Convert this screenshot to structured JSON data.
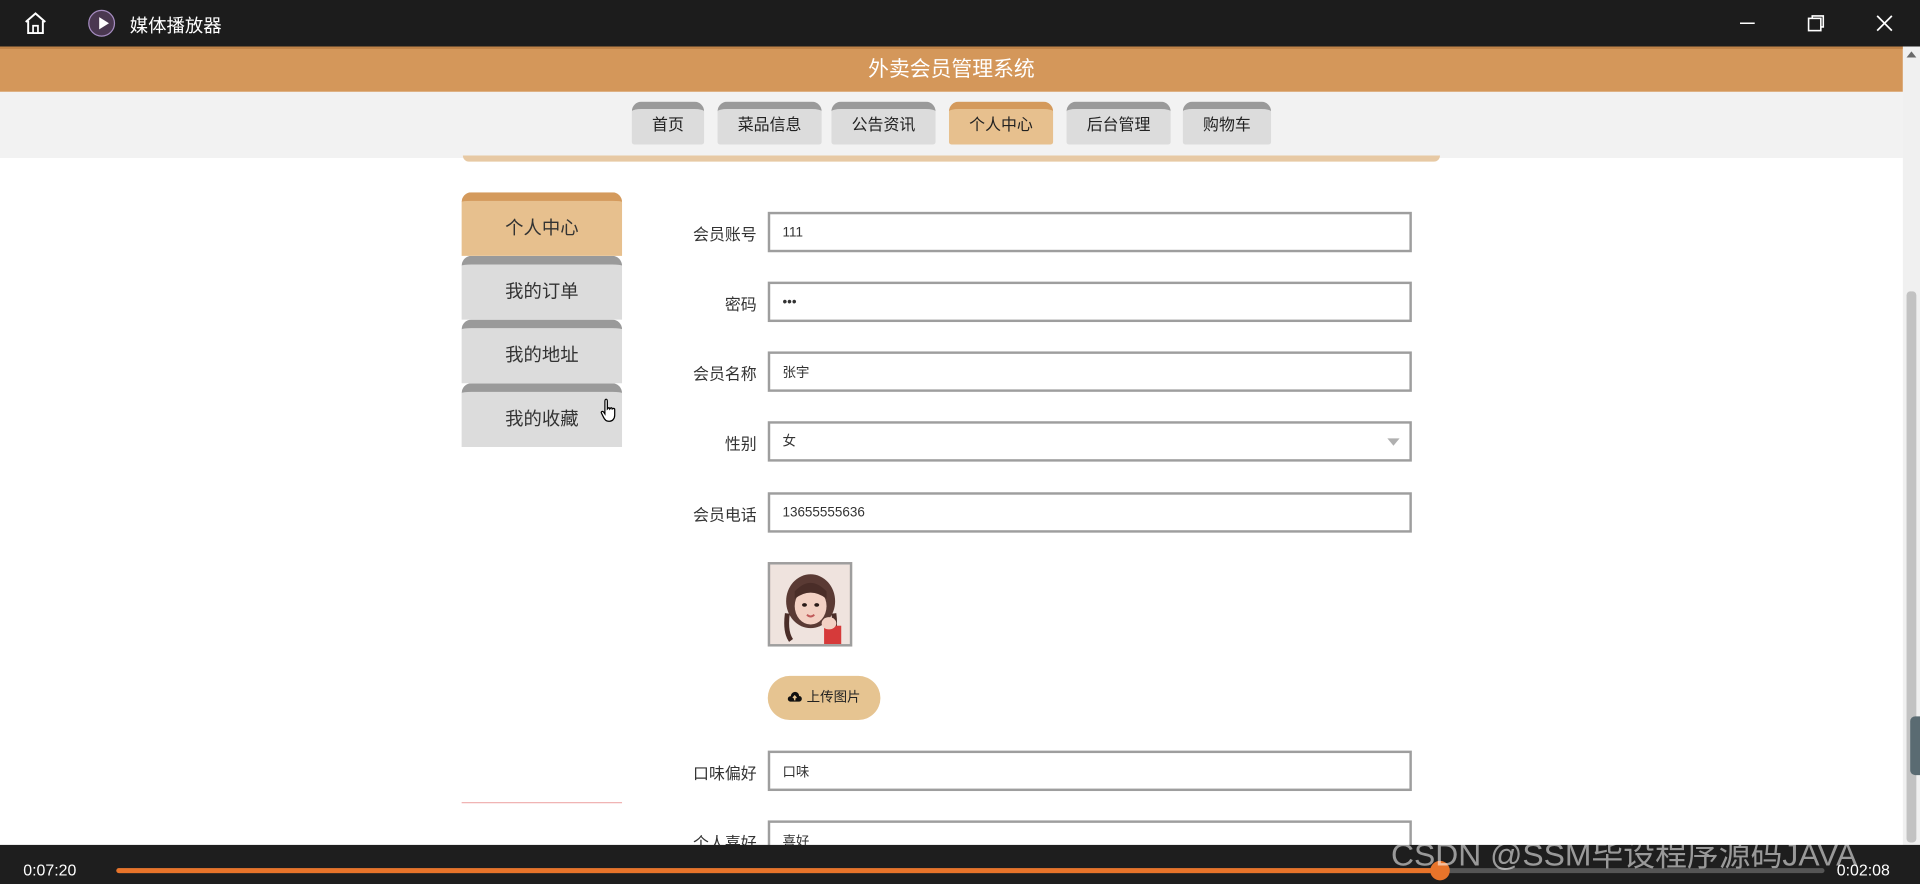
{
  "window": {
    "title": "媒体播放器",
    "icons": [
      "home-icon",
      "media-player-icon",
      "minimize-icon",
      "maximize-icon",
      "close-icon"
    ]
  },
  "site": {
    "title": "外卖会员管理系统",
    "nav": [
      {
        "label": "首页",
        "active": false
      },
      {
        "label": "菜品信息",
        "active": false
      },
      {
        "label": "公告资讯",
        "active": false
      },
      {
        "label": "个人中心",
        "active": true
      },
      {
        "label": "后台管理",
        "active": false
      },
      {
        "label": "购物车",
        "active": false
      }
    ],
    "accent_color": "#d4975a",
    "active_tab_color": "#e7c08e"
  },
  "sidebar": {
    "items": [
      {
        "label": "个人中心",
        "active": true
      },
      {
        "label": "我的订单",
        "active": false
      },
      {
        "label": "我的地址",
        "active": false
      },
      {
        "label": "我的收藏",
        "active": false
      }
    ]
  },
  "form": {
    "account": {
      "label": "会员账号",
      "value": "111"
    },
    "password": {
      "label": "密码",
      "value": "•••"
    },
    "name": {
      "label": "会员名称",
      "value": "张宇"
    },
    "gender": {
      "label": "性别",
      "value": "女"
    },
    "phone": {
      "label": "会员电话",
      "value": "13655555636"
    },
    "upload_label": "上传图片",
    "taste": {
      "label": "口味偏好",
      "value": "口味"
    },
    "hobby": {
      "label": "个人喜好",
      "value": "喜好"
    }
  },
  "player": {
    "elapsed": "0:07:20",
    "remaining": "0:02:08",
    "progress": 0.7746,
    "progress_color": "#e8742a"
  },
  "watermark": "CSDN @SSM毕设程序源码JAVA"
}
